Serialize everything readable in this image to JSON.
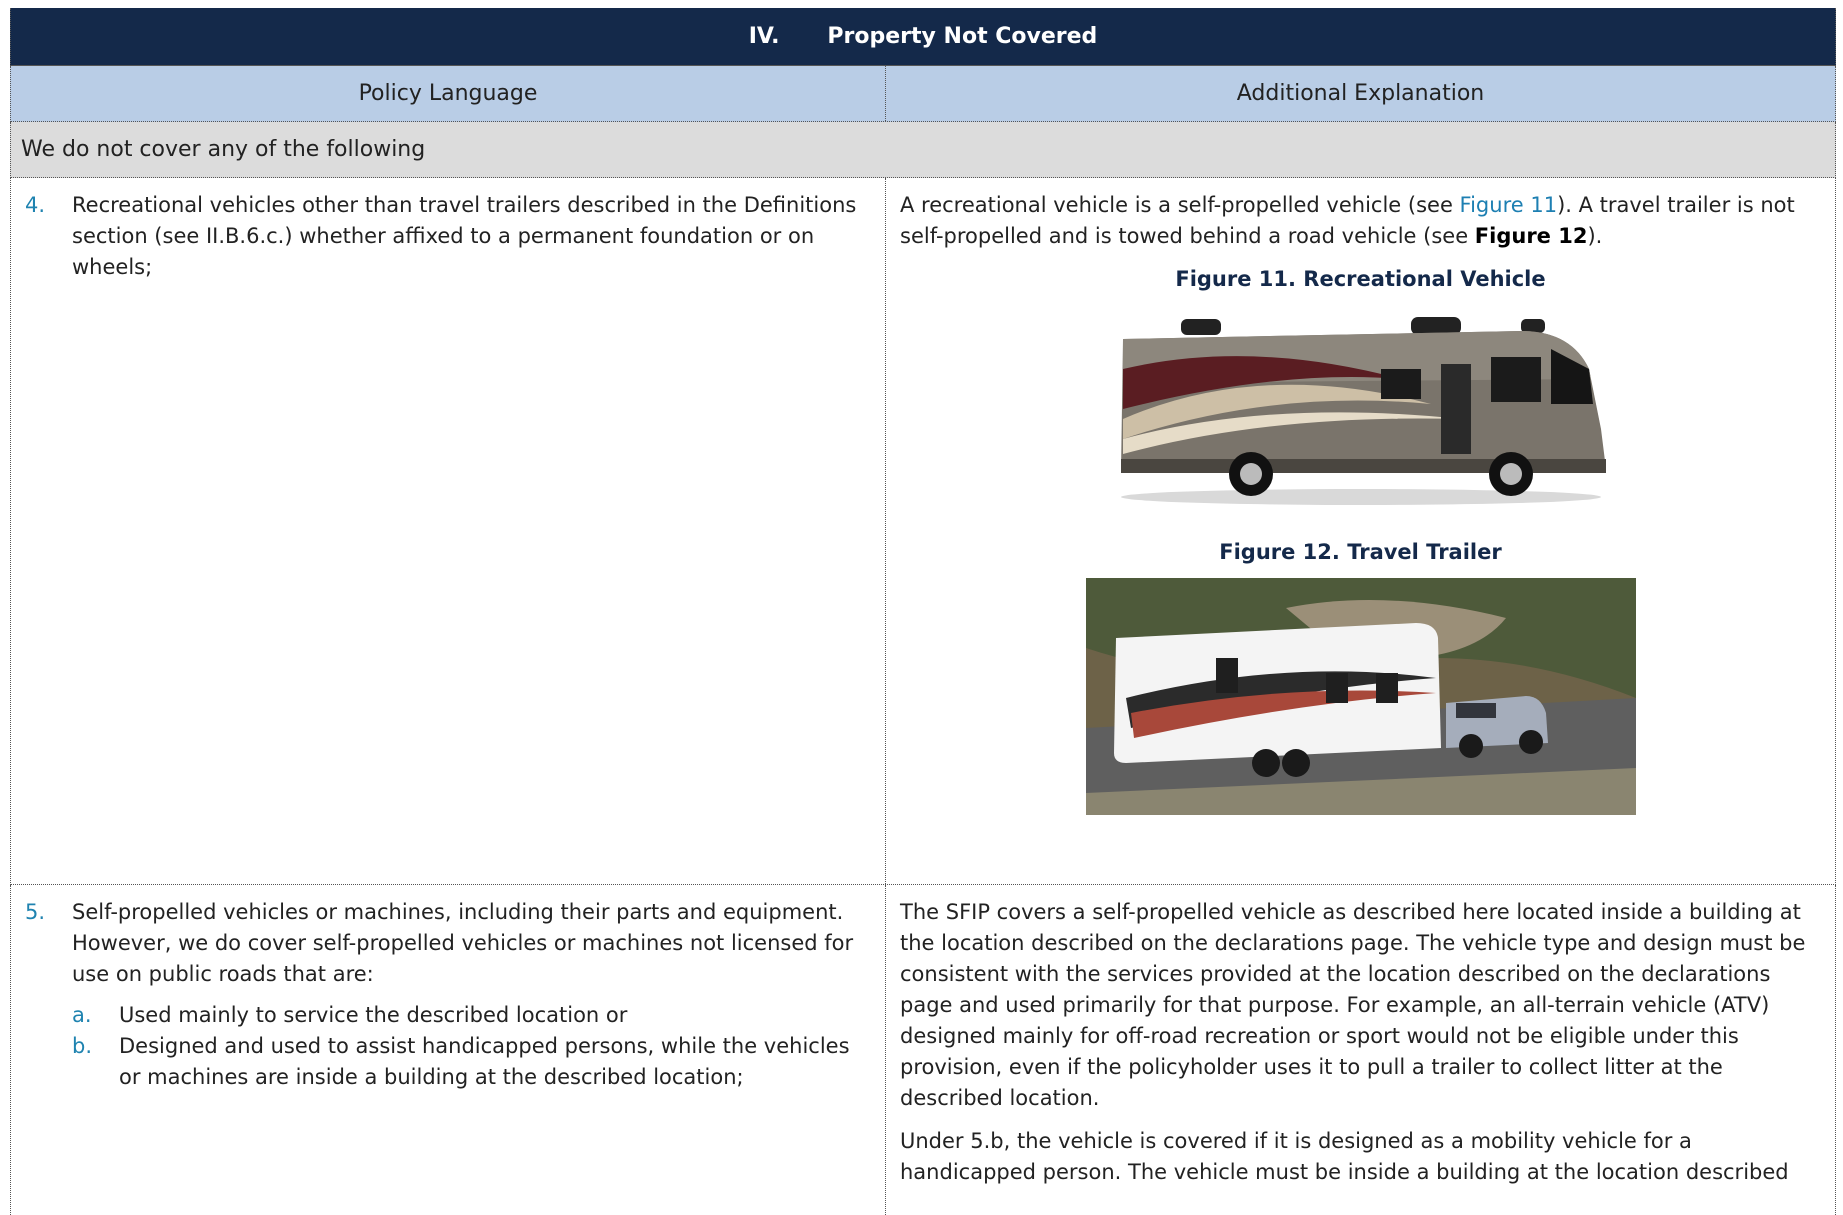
{
  "header": {
    "number": "IV.",
    "title": "Property Not Covered"
  },
  "columns": {
    "left": "Policy Language",
    "right": "Additional Explanation"
  },
  "intro": "We do not cover any of the following",
  "item4": {
    "label": "4.",
    "text": "Recreational vehicles other than travel trailers described in the Definitions section (see II.B.6.c.) whether affixed to a permanent foundation or on wheels;",
    "explanation_part1": "A recreational vehicle is a self-propelled vehicle (see ",
    "explanation_link": "Figure 11",
    "explanation_part2": "). A travel trailer is not self-propelled and is towed behind a road vehicle (see ",
    "explanation_bold": "Figure 12",
    "explanation_part3": ").",
    "figure11_caption": "Figure 11. Recreational Vehicle",
    "figure12_caption": "Figure 12. Travel Trailer"
  },
  "item5": {
    "label": "5.",
    "text": "Self-propelled vehicles or machines, including their parts and equipment. However, we do cover self-propelled vehicles or machines not licensed for use on public roads that are:",
    "sub_a_label": "a.",
    "sub_a_text": "Used mainly to service the described location or",
    "sub_b_label": "b.",
    "sub_b_text": "Designed and used to assist handicapped persons, while the vehicles or machines are inside a building at the described location;",
    "explanation_p1": "The SFIP covers a self-propelled vehicle as described here located inside a building at the location described on the declarations page. The vehicle type and design must be consistent with the services provided at the location described on the declarations page and used primarily for that purpose. For example, an all-terrain vehicle (ATV) designed mainly for off-road recreation or sport would not be eligible under this provision, even if the policyholder uses it to pull a trailer to collect litter at the described location.",
    "explanation_p2": "Under 5.b, the vehicle is covered if it is designed as a mobility vehicle for a handicapped person. The vehicle must be inside a building at the location described"
  }
}
